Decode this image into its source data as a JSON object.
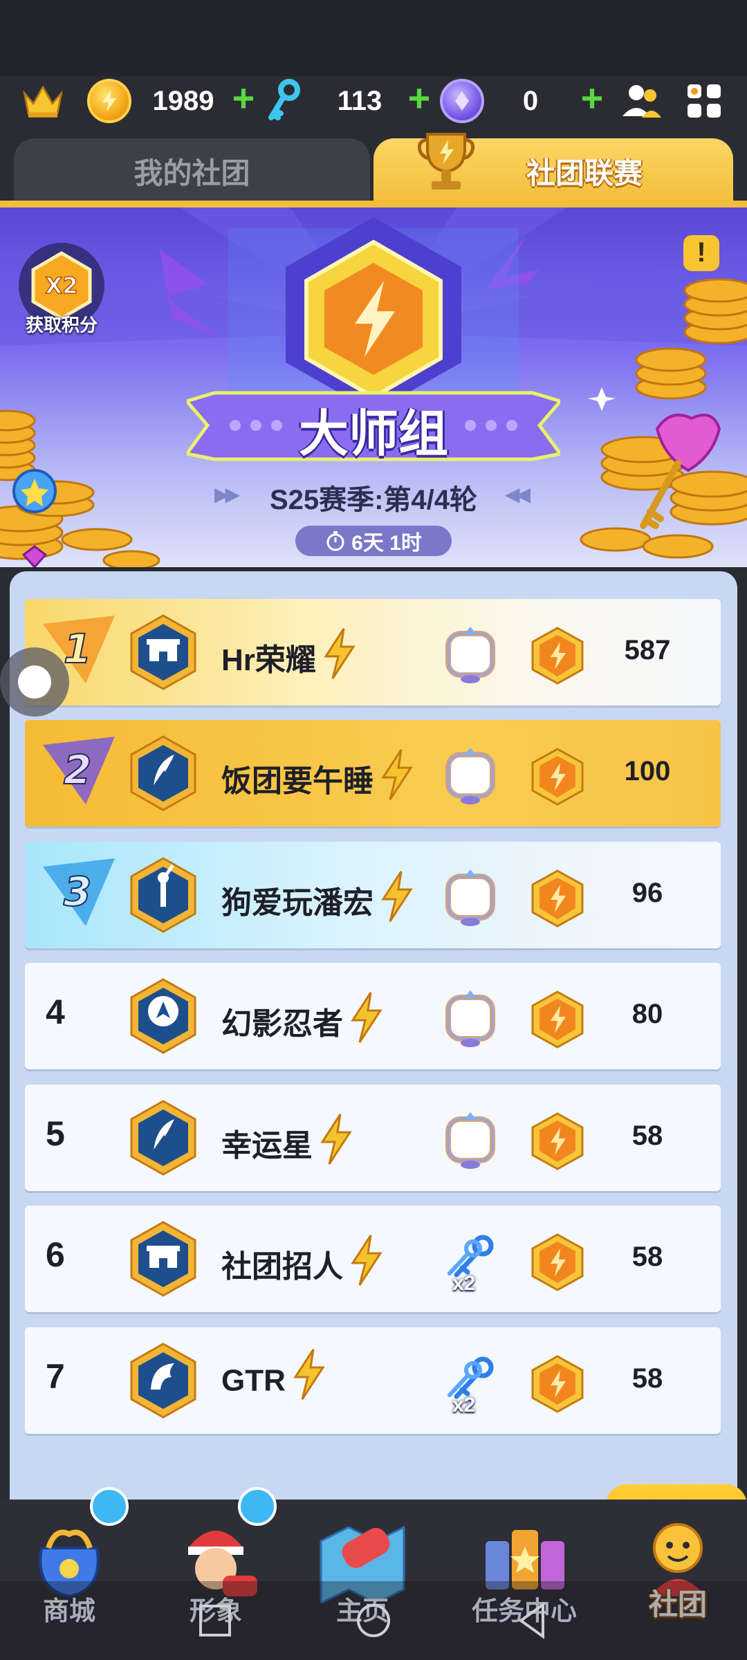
{
  "currencies": {
    "coins": "1989",
    "keys": "113",
    "gems": "0",
    "plus_symbol": "+"
  },
  "tabs": [
    {
      "label": "我的社团",
      "active": false
    },
    {
      "label": "社团联赛",
      "active": true
    }
  ],
  "banner": {
    "multiplier": "X2",
    "multiplier_caption": "获取积分",
    "info_symbol": "!",
    "league_title": "大师组",
    "season_text": "S25赛季:第4/4轮",
    "arrows_left": "▶▶",
    "arrows_right": "◀◀",
    "time_left": "6天 1时"
  },
  "leaderboard": [
    {
      "rank": "1",
      "name": "Hr荣耀",
      "reward": "frame",
      "score": "587",
      "badge": "gate",
      "highlight": "gold"
    },
    {
      "rank": "2",
      "name": "饭团要午睡",
      "reward": "frame",
      "score": "100",
      "badge": "feather",
      "highlight": "silver"
    },
    {
      "rank": "3",
      "name": "狗爱玩潘宏",
      "reward": "frame",
      "score": "96",
      "badge": "statue",
      "highlight": "bronze"
    },
    {
      "rank": "4",
      "name": "幻影忍者",
      "reward": "frame",
      "score": "80",
      "badge": "emblem"
    },
    {
      "rank": "5",
      "name": "幸运星",
      "reward": "frame",
      "score": "58",
      "badge": "feather"
    },
    {
      "rank": "6",
      "name": "社团招人",
      "reward": "keys",
      "reward_label": "x2",
      "score": "58",
      "badge": "gate"
    },
    {
      "rank": "7",
      "name": "GTR",
      "reward": "keys",
      "reward_label": "x2",
      "score": "58",
      "badge": "eagle"
    }
  ],
  "bottom_nav": [
    {
      "label": "商城",
      "icon": "shop-bag-icon",
      "active": false
    },
    {
      "label": "形象",
      "icon": "character-icon",
      "active": false
    },
    {
      "label": "主页",
      "icon": "home-map-icon",
      "active": false
    },
    {
      "label": "任务中心",
      "icon": "task-cans-icon",
      "active": false
    },
    {
      "label": "社团",
      "icon": "club-icon",
      "active": true
    }
  ],
  "colors": {
    "accent_gold": "#f3be3a",
    "banner_purple": "#5a47d6",
    "plus_green": "#59d840",
    "list_bg": "#c8d8f2"
  }
}
